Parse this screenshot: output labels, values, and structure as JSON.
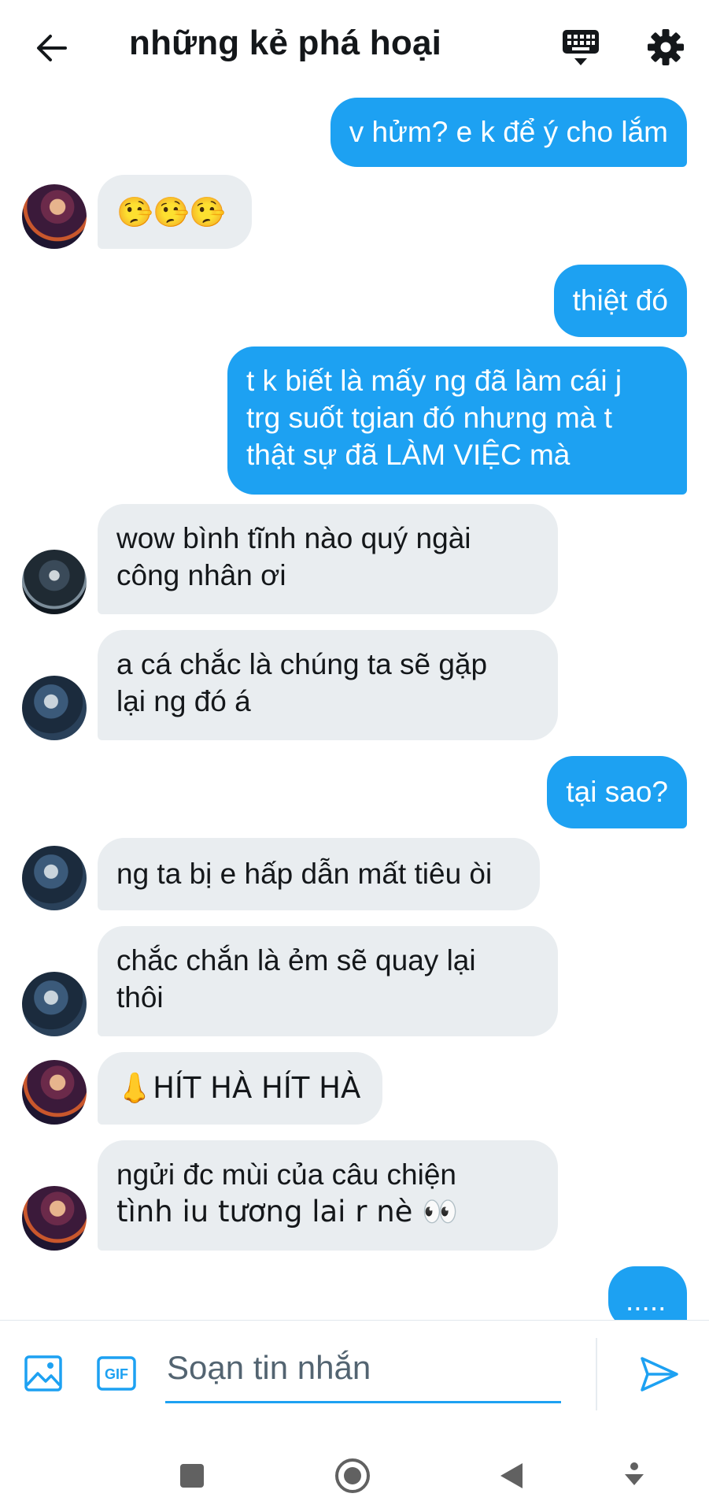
{
  "header": {
    "title": "những kẻ phá hoại",
    "back_icon": "arrow-left-icon",
    "keyboard_icon": "keyboard-icon",
    "settings_icon": "gear-icon"
  },
  "messages": [
    {
      "direction": "out",
      "lines": [
        "v hửm? e k để ý cho lắm"
      ]
    },
    {
      "direction": "in",
      "lines": [
        "🤥🤥🤥"
      ]
    },
    {
      "direction": "out",
      "lines": [
        "thiệt đó"
      ]
    },
    {
      "direction": "out",
      "lines": [
        "t k biết là mấy ng đã làm cái j",
        "trg suốt tgian đó nhưng mà t",
        "thật sự đã LÀM VIỆC mà"
      ]
    },
    {
      "direction": "in",
      "lines": [
        "wow bình tĩnh nào quý ngài",
        "công nhân ơi"
      ]
    },
    {
      "direction": "in",
      "lines": [
        "a cá chắc là chúng ta sẽ gặp",
        "lại ng đó á"
      ]
    },
    {
      "direction": "out",
      "lines": [
        "tại sao?"
      ]
    },
    {
      "direction": "in",
      "lines": [
        "ng ta bị e hấp dẫn mất tiêu òi"
      ]
    },
    {
      "direction": "in",
      "lines": [
        "chắc chắn là ẻm sẽ quay lại",
        "thôi"
      ]
    },
    {
      "direction": "in",
      "lines": [
        "👃HÍT HÀ HÍT HÀ"
      ]
    },
    {
      "direction": "in",
      "lines": [
        "ngửi đc mùi của câu chiện",
        "tình iu tương lai r nè 👀"
      ]
    },
    {
      "direction": "out",
      "lines": [
        "....."
      ]
    }
  ],
  "composer": {
    "placeholder": "Soạn tin nhắn",
    "image_icon": "image-icon",
    "gif_icon": "gif-icon",
    "gif_label": "GIF",
    "send_icon": "send-icon"
  },
  "navbar": {
    "icons": [
      "square-icon",
      "home-circle-icon",
      "back-triangle-icon",
      "accessibility-icon"
    ]
  },
  "colors": {
    "accent": "#1da1f2",
    "incoming_bubble": "#e9edf0"
  }
}
